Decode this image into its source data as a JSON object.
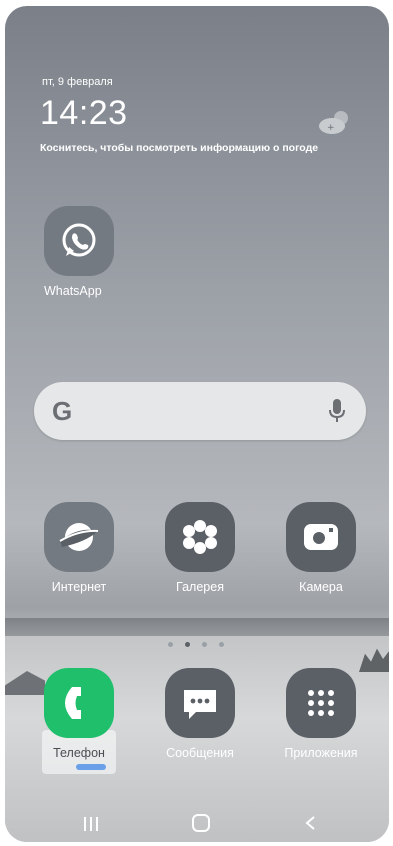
{
  "status": {
    "date": "пт, 9 февраля",
    "time": "14:23",
    "weather_hint": "Коснитесь, чтобы посмотреть информацию о погоде"
  },
  "apps": {
    "whatsapp": "WhatsApp",
    "internet": "Интернет",
    "gallery": "Галерея",
    "camera": "Камера"
  },
  "dock": {
    "phone": "Телефон",
    "messages": "Сообщения",
    "apps": "Приложения"
  },
  "search": {
    "logo": "G"
  },
  "page_indicator": {
    "count": 4,
    "active_index": 1
  },
  "colors": {
    "phone_accent": "#1fbf6c",
    "icon_gray": "#747a82"
  }
}
